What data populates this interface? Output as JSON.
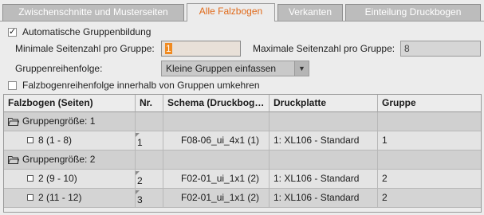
{
  "tabs": [
    {
      "label": "Zwischenschnitte und Musterseiten",
      "active": false
    },
    {
      "label": "Alle Falzbogen",
      "active": true
    },
    {
      "label": "Verkanten",
      "active": false
    },
    {
      "label": "Einteilung Druckbogen",
      "active": false
    }
  ],
  "auto_group": {
    "label": "Automatische Gruppenbildung",
    "checked": true,
    "check_glyph": "✓"
  },
  "min_pages": {
    "label": "Minimale Seitenzahl pro Gruppe:",
    "value": "1"
  },
  "max_pages": {
    "label": "Maximale Seitenzahl pro Gruppe:",
    "value": "8"
  },
  "group_order": {
    "label": "Gruppenreihenfolge:",
    "value": "Kleine Gruppen einfassen",
    "arrow": "▼"
  },
  "reverse": {
    "label": "Falzbogenreihenfolge innerhalb von Gruppen umkehren",
    "checked": false
  },
  "table": {
    "columns": [
      "Falzbogen (Seiten)",
      "Nr.",
      "Schema (Druckbog…",
      "Druckplatte",
      "Gruppe"
    ],
    "groups": [
      {
        "label": "Gruppengröße: 1",
        "rows": [
          {
            "falzbogen": "8 (1 - 8)",
            "nr": "1",
            "schema": "F08-06_ui_4x1  (1)",
            "druckplatte": "1: XL106 - Standard",
            "gruppe": "1"
          }
        ]
      },
      {
        "label": "Gruppengröße: 2",
        "rows": [
          {
            "falzbogen": "2 (9 - 10)",
            "nr": "2",
            "schema": "F02-01_ui_1x1  (2)",
            "druckplatte": "1: XL106 - Standard",
            "gruppe": "2"
          },
          {
            "falzbogen": "2 (11 - 12)",
            "nr": "3",
            "schema": "F02-01_ui_1x1  (2)",
            "druckplatte": "1: XL106 - Standard",
            "gruppe": "2"
          }
        ]
      }
    ]
  },
  "colors": {
    "accent": "#e06a1a",
    "field_highlight": "#f08a20"
  }
}
